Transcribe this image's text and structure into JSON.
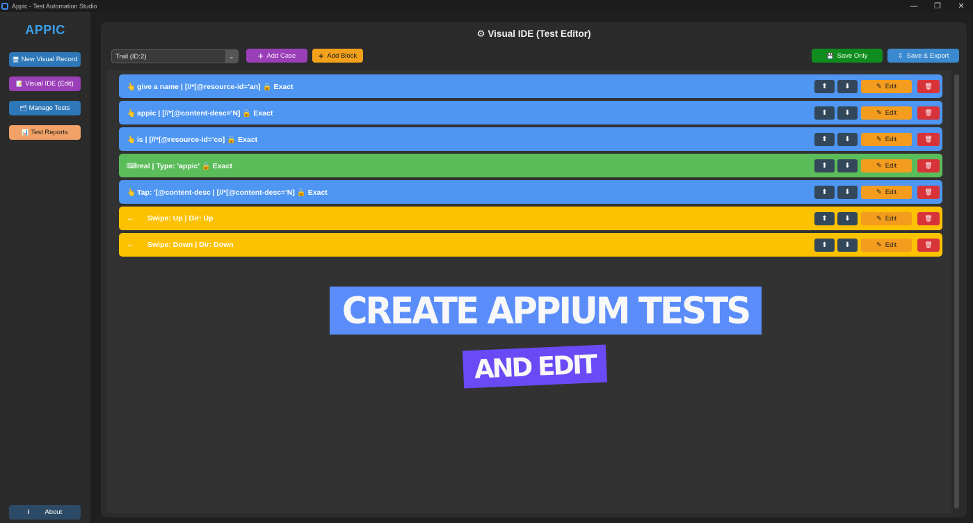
{
  "window": {
    "title": "Appic - Test Automation Studio",
    "controls": {
      "minimize": "—",
      "restore": "❐",
      "close": "✕"
    }
  },
  "sidebar": {
    "logo": "APPIC",
    "items": [
      {
        "icon": "🖥",
        "label": "New Visual Record",
        "color": "#2e77b8"
      },
      {
        "icon": "📝",
        "label": "Visual IDE (Edit)",
        "color": "#9b3fb8"
      },
      {
        "icon": "🗂",
        "label": "Manage Tests",
        "color": "#2e77b8"
      },
      {
        "icon": "📊",
        "label": "Test Reports",
        "color": "#f2a267"
      }
    ],
    "about": {
      "icon": "i",
      "label": "About"
    }
  },
  "editor": {
    "title_icon": "⚙",
    "title": "Visual IDE (Test Editor)",
    "trail_select": {
      "value": "Trail (ID:2)",
      "arrow": "⌄"
    },
    "toolbar": {
      "add_case": "Add Case",
      "add_block": "Add Block",
      "save_only_icon": "💾",
      "save_only": "Save Only",
      "save_export_icon": "⇩",
      "save_export": "Save & Export",
      "plus": "+"
    },
    "step_buttons": {
      "up": "⬆",
      "down": "⬇",
      "edit_icon": "✎",
      "edit": "Edit",
      "delete": "🗑"
    },
    "steps": [
      {
        "type": "tap",
        "color": "blue",
        "icon": "👆",
        "text": "give a name | [//*[@resource-id='an] 🔒 Exact"
      },
      {
        "type": "tap",
        "color": "blue",
        "icon": "👆",
        "text": "appic | [//*[@content-desc='N] 🔒 Exact"
      },
      {
        "type": "tap",
        "color": "blue",
        "icon": "👆",
        "text": "is | [//*[@resource-id='co] 🔒 Exact"
      },
      {
        "type": "input",
        "color": "green",
        "icon": "⌨",
        "text": "real | Type: 'appic' 🔒 Exact"
      },
      {
        "type": "tap",
        "color": "blue",
        "icon": "👆",
        "text": "Tap: '[@content-desc | [//*[@content-desc='N] 🔒 Exact"
      },
      {
        "type": "swipe",
        "color": "yellow",
        "icon": "↔",
        "text": "Swipe: Up | Dir: Up"
      },
      {
        "type": "swipe",
        "color": "yellow",
        "icon": "↔",
        "text": "Swipe: Down | Dir: Down"
      }
    ]
  },
  "promo": {
    "line1": "CREATE APPIUM TESTS",
    "line2": "AND EDIT"
  },
  "colors": {
    "tap_step": "#4e96f1",
    "input_step": "#5bbc5a",
    "swipe_step": "#fcc202",
    "accent": "#3aa0e8"
  }
}
